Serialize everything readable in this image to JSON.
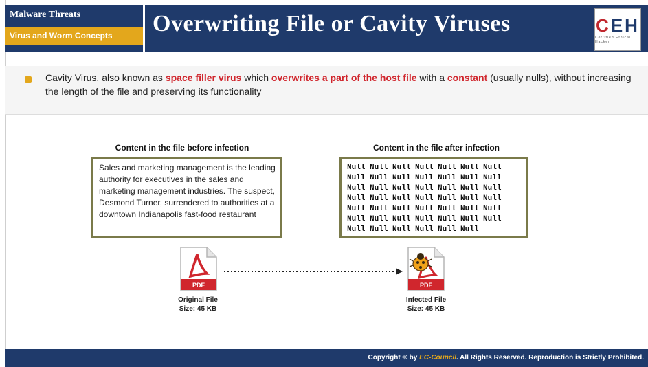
{
  "header": {
    "section": "Malware Threats",
    "subsection": "Virus and Worm Concepts",
    "title": "Overwriting File or Cavity Viruses",
    "logo": {
      "c": "C",
      "eh": "EH",
      "tagline": "Certified Ethical Hacker"
    }
  },
  "bullet": {
    "p1": "Cavity Virus, also known as ",
    "r1": "space filler virus",
    "p2": " which ",
    "r2": "overwrites a part of the host file",
    "p3": " with a ",
    "r3": "constant",
    "p4": " (usually nulls), without increasing the length of the file and preserving its functionality"
  },
  "before": {
    "label": "Content in the file before infection",
    "text": "Sales and marketing management is the leading authority for executives in the sales and marketing management industries. The suspect, Desmond Turner, surrendered to authorities at a downtown Indianapolis fast-food restaurant"
  },
  "after": {
    "label": "Content in the file after infection",
    "rows": [
      "Null Null Null Null Null Null Null",
      "Null Null Null Null Null Null Null",
      "Null Null Null Null Null Null Null",
      "Null Null Null Null Null Null Null",
      "Null Null Null Null Null Null Null",
      "Null Null Null Null Null Null Null",
      "Null Null Null Null Null Null"
    ]
  },
  "original_file": {
    "name": "Original File",
    "size": "Size: 45 KB",
    "badge": "PDF"
  },
  "infected_file": {
    "name": "Infected File",
    "size": "Size: 45 KB",
    "badge": "PDF"
  },
  "footer": {
    "pre": "Copyright © by ",
    "brand": "EC-Council",
    "post": ". All Rights Reserved. Reproduction is Strictly Prohibited."
  },
  "colors": {
    "navy": "#1f3a6b",
    "gold": "#e3a71c",
    "red": "#d0262d"
  }
}
